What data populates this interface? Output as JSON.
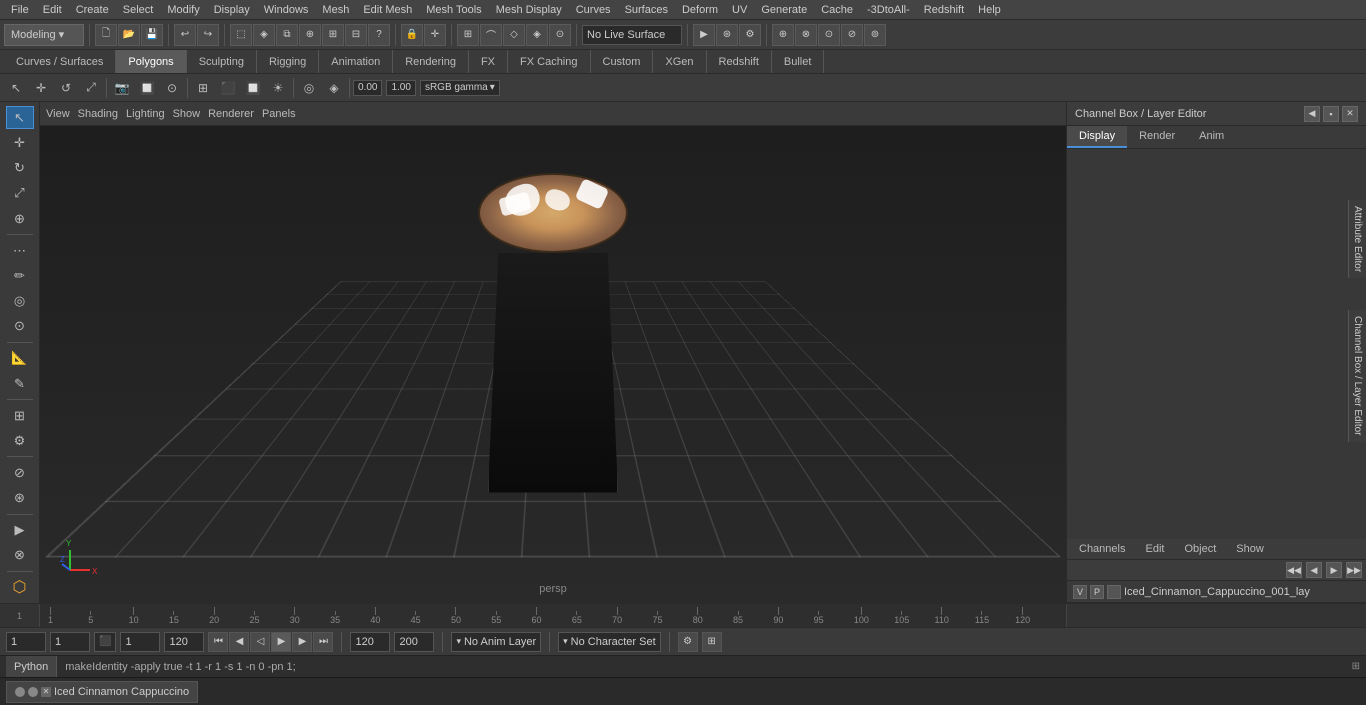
{
  "menubar": {
    "items": [
      "File",
      "Edit",
      "Create",
      "Select",
      "Modify",
      "Display",
      "Windows",
      "Mesh",
      "Edit Mesh",
      "Mesh Tools",
      "Mesh Display",
      "Curves",
      "Surfaces",
      "Deform",
      "UV",
      "Generate",
      "Cache",
      "-3DtoAll-",
      "Redshift",
      "Help"
    ]
  },
  "toolbar1": {
    "workspace_label": "Modeling",
    "workspace_arrow": "▾"
  },
  "workspace_tabs": {
    "items": [
      "Curves / Surfaces",
      "Polygons",
      "Sculpting",
      "Rigging",
      "Animation",
      "Rendering",
      "FX",
      "FX Caching",
      "Custom",
      "XGen",
      "Redshift",
      "Bullet"
    ],
    "active": "Polygons"
  },
  "viewport": {
    "header_items": [
      "View",
      "Shading",
      "Lighting",
      "Show",
      "Renderer",
      "Panels"
    ],
    "persp_label": "persp",
    "gamma_label": "sRGB gamma",
    "gamma_value": "0.00",
    "gamma_value2": "1.00"
  },
  "right_panel": {
    "title": "Channel Box / Layer Editor",
    "tabs": [
      "Display",
      "Render",
      "Anim"
    ],
    "active_tab": "Display",
    "sub_tabs": [
      "Channels",
      "Edit",
      "Object",
      "Show"
    ],
    "layer_arrows": [
      "◀◀",
      "◀",
      "▶",
      "▶▶"
    ],
    "layer": {
      "v": "V",
      "p": "P",
      "name": "Iced_Cinnamon_Cappuccino_001_lay"
    }
  },
  "timeline": {
    "start": "1",
    "end": "120",
    "current": "1",
    "range_end": "200",
    "marks": [
      "1",
      "5",
      "10",
      "15",
      "20",
      "25",
      "30",
      "35",
      "40",
      "45",
      "50",
      "55",
      "60",
      "65",
      "70",
      "75",
      "80",
      "85",
      "90",
      "95",
      "100",
      "105",
      "110",
      "115",
      "120"
    ]
  },
  "bottom_bar": {
    "frame1": "1",
    "frame2": "1",
    "frame3": "1",
    "anim_layer": "No Anim Layer",
    "char_set": "No Character Set",
    "start_frame": "120",
    "end_frame": "120",
    "end_frame2": "200"
  },
  "status_bar": {
    "lang": "Python",
    "command": "makeIdentity -apply true -t 1 -r 1 -s 1 -n 0 -pn 1;"
  },
  "taskbar": {
    "window_title": "Iced Cinnamon Cappuccino",
    "close_btn": "✕",
    "min_btn": "—",
    "max_btn": "□"
  },
  "icons": {
    "select": "↖",
    "move": "✛",
    "rotate": "↺",
    "scale": "⤢",
    "universal": "⊕",
    "lasso": "⋯",
    "paint": "✏",
    "soft": "◎",
    "sculpt": "⊙",
    "grid": "⊞",
    "snap": "⊘",
    "arrow_left": "◄",
    "arrow_right": "►",
    "play": "▶",
    "stop": "■",
    "prev": "◀",
    "next": "▶",
    "skip_start": "◀◀",
    "skip_end": "▶▶"
  }
}
